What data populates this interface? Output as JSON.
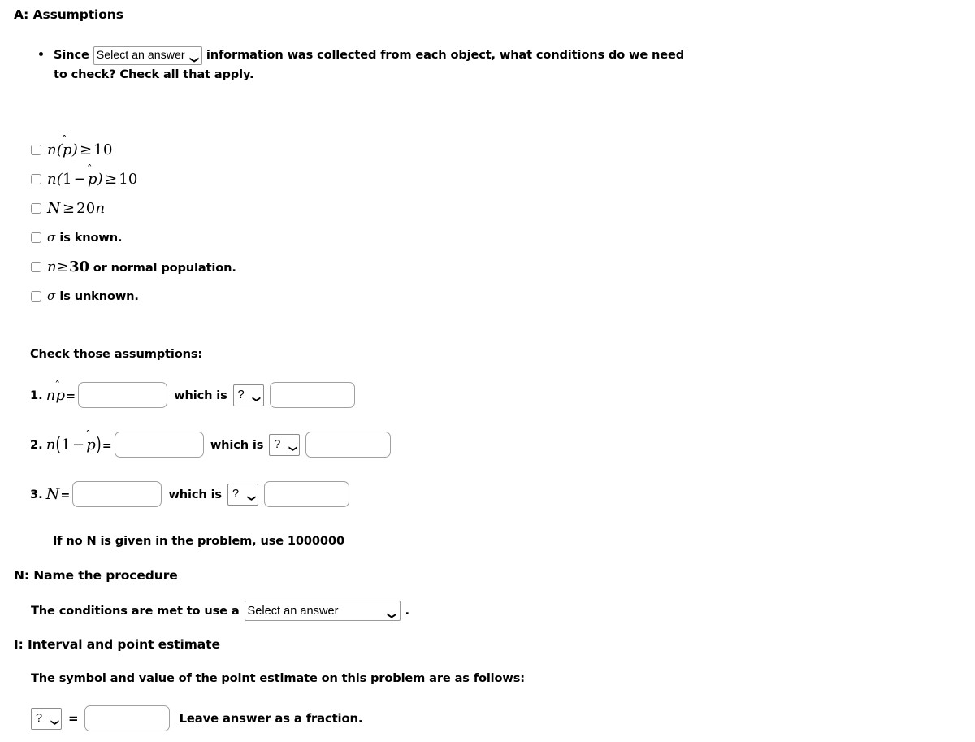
{
  "sections": {
    "assumptions": {
      "heading": "A: Assumptions",
      "bullet": {
        "text_before": "Since",
        "select": {
          "value": "Select an answer",
          "options": [
            "Select an answer"
          ]
        },
        "text_after": "information was collected from each object, what conditions do we need",
        "text_line2": "to check?  Check all that apply."
      },
      "checkbox_options": [
        {
          "id": "n-phat-ge-10",
          "label": "n(p̂) ≥ 10",
          "checked": false
        },
        {
          "id": "n-1-minus-phat-ge-10",
          "label": "n(1 − p̂) ≥ 10",
          "checked": false
        },
        {
          "id": "N-ge-20n",
          "label": "N ≥ 20n",
          "checked": false
        },
        {
          "id": "sigma-known",
          "label": "σ is known.",
          "checked": false
        },
        {
          "id": "n-ge-30-normal",
          "label": "n ≥ 30 or normal population.",
          "checked": false
        },
        {
          "id": "sigma-unknown",
          "label": "σ is unknown.",
          "checked": false
        }
      ],
      "check_prompt": "Check those assumptions:",
      "rows": [
        {
          "index": "1.",
          "symbol": "np̂=",
          "value": "",
          "which_label": "which is",
          "which_select": {
            "value": "?",
            "options": [
              "?"
            ]
          },
          "result": ""
        },
        {
          "index": "2.",
          "symbol": "n(1 − p̂)=",
          "value": "",
          "which_label": "which is",
          "which_select": {
            "value": "?",
            "options": [
              "?"
            ]
          },
          "result": ""
        },
        {
          "index": "3.",
          "symbol": "N=",
          "value": "",
          "which_label": "which is",
          "which_select": {
            "value": "?",
            "options": [
              "?"
            ]
          },
          "result": ""
        }
      ],
      "note": "If no N is given in the problem, use 1000000"
    },
    "name_procedure": {
      "heading": "N: Name the procedure",
      "text_before": "The conditions are met to use a",
      "select": {
        "value": "Select an answer",
        "options": [
          "Select an answer"
        ]
      },
      "text_after": "."
    },
    "interval": {
      "heading": "I: Interval and point estimate",
      "description": "The symbol and value of the point estimate on this problem are as follows:",
      "symbol_select": {
        "value": "?",
        "options": [
          "?"
        ]
      },
      "equals": "=",
      "value": "",
      "hint": "Leave answer as a fraction."
    }
  },
  "icons": {
    "chevron_down": "⌄"
  },
  "colors": {
    "text": "#000000",
    "border": "#a0a0a0",
    "select_border": "#9a9a9a",
    "background": "#ffffff"
  }
}
